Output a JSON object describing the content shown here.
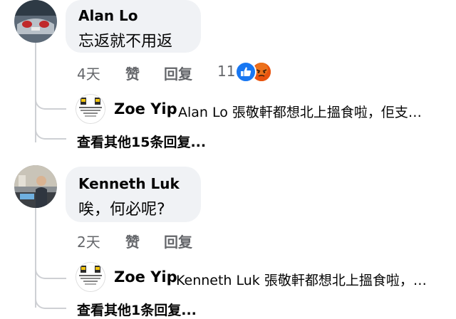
{
  "comments": [
    {
      "author": "Alan Lo",
      "text": "忘返就不用返",
      "time": "4天",
      "like_label": "赞",
      "reply_label": "回复",
      "reaction_count": "11",
      "reactions": [
        "like",
        "angry"
      ],
      "reply_preview": {
        "author": "Zoe Yip",
        "text": "Alan Lo 張敬軒都想北上搵食啦，佢支…"
      },
      "more_replies": "查看其他15条回复..."
    },
    {
      "author": "Kenneth Luk",
      "text": "唉，何必呢?",
      "time": "2天",
      "like_label": "赞",
      "reply_label": "回复",
      "reply_preview": {
        "author": "Zoe Yip",
        "text": "Kenneth Luk 張敬軒都想北上搵食啦，…"
      },
      "more_replies": "查看其他1条回复..."
    }
  ],
  "colors": {
    "bubble": "#f0f2f5",
    "meta": "#65676b",
    "like": "#1877f2",
    "angry": "#e9710f",
    "thread": "#ced0d4"
  }
}
